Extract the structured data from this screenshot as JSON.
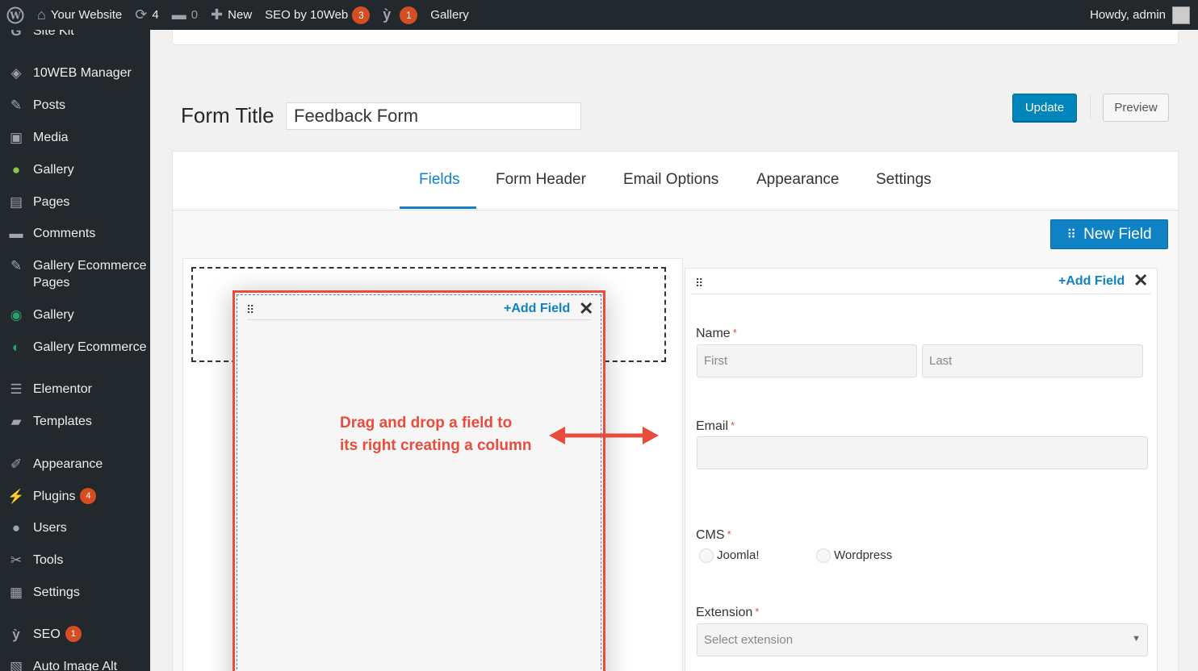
{
  "adminbar": {
    "site_name": "Your Website",
    "updates_count": "4",
    "comments_count": "0",
    "new_label": "New",
    "seo_label": "SEO by 10Web",
    "seo_count": "3",
    "yoast_count": "1",
    "gallery_label": "Gallery",
    "greeting": "Howdy, admin"
  },
  "sidebar": {
    "items": [
      {
        "label": "Site Kit",
        "icon": "google-g-icon"
      },
      {
        "label": "10WEB Manager",
        "icon": "diamond-icon"
      },
      {
        "label": "Posts",
        "icon": "pin-icon"
      },
      {
        "label": "Media",
        "icon": "media-icon"
      },
      {
        "label": "Gallery",
        "icon": "gallery-icon"
      },
      {
        "label": "Pages",
        "icon": "pages-icon"
      },
      {
        "label": "Comments",
        "icon": "comment-icon"
      },
      {
        "label": "Gallery Ecommerce Pages",
        "icon": "pin-icon"
      },
      {
        "label": "Gallery",
        "icon": "camera-icon"
      },
      {
        "label": "Gallery Ecommerce",
        "icon": "eye-icon"
      },
      {
        "label": "Elementor",
        "icon": "elementor-icon"
      },
      {
        "label": "Templates",
        "icon": "folder-icon"
      },
      {
        "label": "Appearance",
        "icon": "brush-icon"
      },
      {
        "label": "Plugins",
        "icon": "plug-icon",
        "badge": "4"
      },
      {
        "label": "Users",
        "icon": "user-icon"
      },
      {
        "label": "Tools",
        "icon": "wrench-icon"
      },
      {
        "label": "Settings",
        "icon": "sliders-icon"
      },
      {
        "label": "SEO",
        "icon": "yoast-icon",
        "badge": "1"
      },
      {
        "label": "Auto Image Alt",
        "icon": "image-icon"
      }
    ]
  },
  "form": {
    "title_label": "Form Title",
    "title_value": "Feedback Form",
    "update_label": "Update",
    "preview_label": "Preview"
  },
  "tabs": [
    "Fields",
    "Form Header",
    "Email Options",
    "Appearance",
    "Settings"
  ],
  "active_tab": "Fields",
  "new_field_label": "New Field",
  "add_field_label": "Add Field",
  "annotation": {
    "line1": "Drag and drop a field to",
    "line2": "its right creating a column"
  },
  "fields": {
    "name_label": "Name",
    "first_placeholder": "First",
    "last_placeholder": "Last",
    "email_label": "Email",
    "cms_label": "CMS",
    "cms_options": [
      "Joomla!",
      "Wordpress"
    ],
    "extension_label": "Extension",
    "extension_placeholder": "Select extension",
    "required_mark": "*"
  },
  "colors": {
    "accent": "#0f82c5",
    "annotation": "#e74c3c",
    "admin_dark": "#23282d",
    "badge": "#d54e21"
  }
}
